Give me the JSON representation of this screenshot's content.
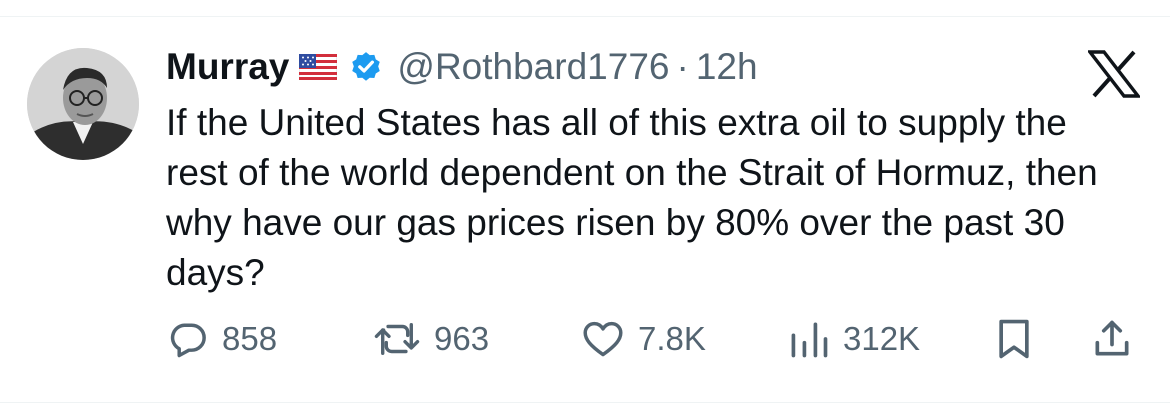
{
  "author": {
    "display_name": "Murray",
    "handle": "@Rothbard1776",
    "separator": "·",
    "time": "12h",
    "flag_icon": "us-flag-icon",
    "verified_icon": "verified-badge-icon"
  },
  "platform_icon": "x-logo-icon",
  "tweet": {
    "text": "If the United States has all of this extra oil to supply the rest of the world dependent on the Strait of Hormuz, then why have our gas prices risen by 80% over the past 30 days?"
  },
  "actions": {
    "replies": "858",
    "reposts": "963",
    "likes": "7.8K",
    "views": "312K"
  },
  "colors": {
    "text": "#0f1419",
    "secondary": "#536471",
    "verified": "#1d9bf0",
    "divider": "#eff3f4"
  }
}
